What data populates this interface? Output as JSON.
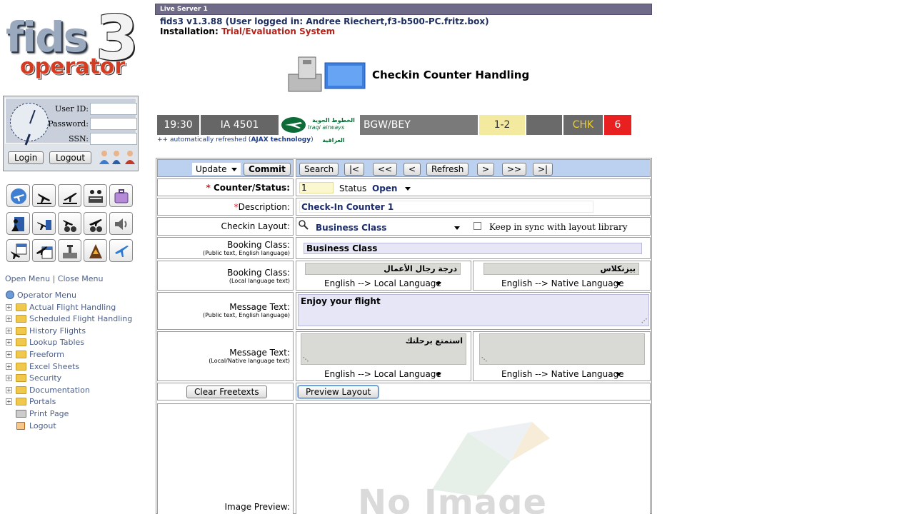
{
  "server": {
    "label": "Live Server 1"
  },
  "header": {
    "version_line": "fids3 v1.3.88   (User logged in: Andree Riechert,f3-b500-PC.fritz.box)",
    "install_label": "Installation:",
    "install_value": "Trial/Evaluation System"
  },
  "page": {
    "title": "Checkin Counter Handling"
  },
  "login": {
    "userid_label": "User ID:",
    "password_label": "Password:",
    "ssn_label": "SSN:",
    "login_button": "Login",
    "logout_button": "Logout"
  },
  "menu": {
    "open_label": "Open Menu",
    "separator": "|",
    "close_label": "Close Menu",
    "root": "Operator Menu",
    "items": [
      {
        "label": "Actual Flight Handling"
      },
      {
        "label": "Scheduled Flight Handling"
      },
      {
        "label": "History Flights"
      },
      {
        "label": "Lookup Tables"
      },
      {
        "label": "Freeform"
      },
      {
        "label": "Excel Sheets"
      },
      {
        "label": "Security"
      },
      {
        "label": "Documentation"
      },
      {
        "label": "Portals"
      }
    ],
    "print_label": "Print Page",
    "logout_label": "Logout"
  },
  "icons": [
    "airplane-icon",
    "arrivals-icon",
    "departures-icon",
    "checkin-desk-icon",
    "baggage-icon",
    "passenger-door-icon",
    "gate-icon",
    "binoculars-arrival-icon",
    "binoculars-departure-icon",
    "speaker-icon",
    "calendar-arrival-icon",
    "calendar-departure-icon",
    "airport-icon",
    "airline-tail-icon",
    "plane-blue-icon"
  ],
  "flight": {
    "time": "19:30",
    "flight_no": "IA 4501",
    "airline_logo_text_ar": "الخطوط الجوية العراقية",
    "airline_logo_text_en": "Iraqi airways",
    "route": "BGW/BEY",
    "counter": "1-2",
    "blank": "",
    "status": "CHK",
    "number": "6",
    "colors": {
      "time_bg": "#666666",
      "route_bg": "#7a7a7a",
      "counter_bg": "#f3eaa0",
      "status_bg": "#6a6a6a",
      "status_fg": "#f0d020",
      "number_bg": "#e82020"
    }
  },
  "auto_refresh": {
    "prefix": "++ automatically refreshed (",
    "tech": "AJAX technology",
    "suffix": ")"
  },
  "toolbar": {
    "mode_value": "Update",
    "commit": "Commit",
    "search": "Search",
    "first": "|<",
    "prev_page": "<<",
    "prev": "<",
    "refresh": "Refresh",
    "next": ">",
    "next_page": ">>",
    "last": ">|"
  },
  "form": {
    "counter_status_label": "Counter/Status:",
    "counter_value": "1",
    "status_label": "Status",
    "status_value": "Open",
    "description_label": "Description:",
    "description_value": "Check-In Counter 1",
    "layout_label": "Checkin Layout:",
    "layout_value": "Business Class",
    "sync_label": "Keep in sync with layout library",
    "booking_public_label": "Booking Class:",
    "booking_public_sub": "(Public text, English language)",
    "booking_public_value": "Business Class",
    "booking_local_label": "Booking Class:",
    "booking_local_sub": "(Local language text)",
    "booking_local_ar": "درجة رجال الأعمال",
    "booking_native_fa": "بيزنكلاس",
    "translate_local": "English --> Local Language",
    "translate_native": "English --> Native Language",
    "message_public_label": "Message Text:",
    "message_public_sub": "(Public text, English language)",
    "message_public_value": "Enjoy your flight",
    "message_local_label": "Message Text:",
    "message_local_sub": "(Local/Native language text)",
    "message_local_ar": "استمتع برحلتك",
    "message_native_value": "",
    "clear_button": "Clear Freetexts",
    "preview_button": "Preview Layout",
    "image_preview_label": "Image Preview:",
    "no_image_text": "No Image"
  }
}
